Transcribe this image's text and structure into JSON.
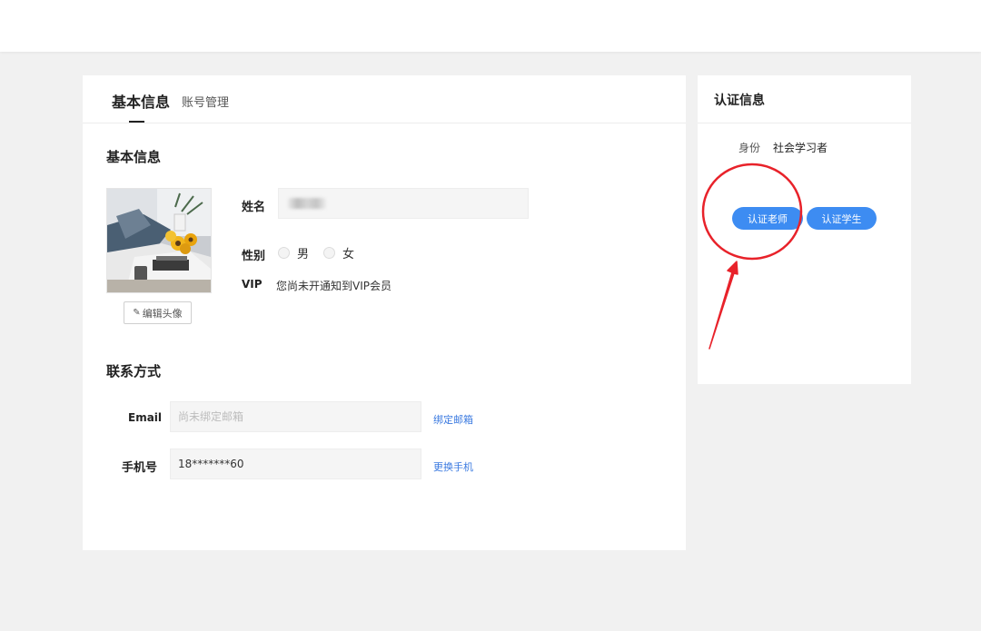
{
  "tabs": {
    "active_label": "基本信息",
    "second_label": "账号管理"
  },
  "basic": {
    "section_title": "基本信息",
    "edit_avatar_label": "编辑头像",
    "name_label": "姓名",
    "gender_label": "性别",
    "gender_options": [
      "男",
      "女"
    ],
    "vip_label": "VIP",
    "vip_text": "您尚未开通知到VIP会员"
  },
  "contact": {
    "section_title": "联系方式",
    "email_label": "Email",
    "email_placeholder": "尚未绑定邮箱",
    "email_link": "绑定邮箱",
    "phone_label": "手机号",
    "phone_value": "18*******60",
    "phone_link": "更换手机"
  },
  "certification": {
    "title": "认证信息",
    "identity_label": "身份",
    "identity_value": "社会学习者",
    "teacher_button": "认证老师",
    "student_button": "认证学生"
  },
  "colors": {
    "accent": "#3d8cf2",
    "link": "#3b7ae0",
    "annotation": "#e8222a"
  },
  "icons": {
    "edit_avatar": "edit-icon"
  }
}
